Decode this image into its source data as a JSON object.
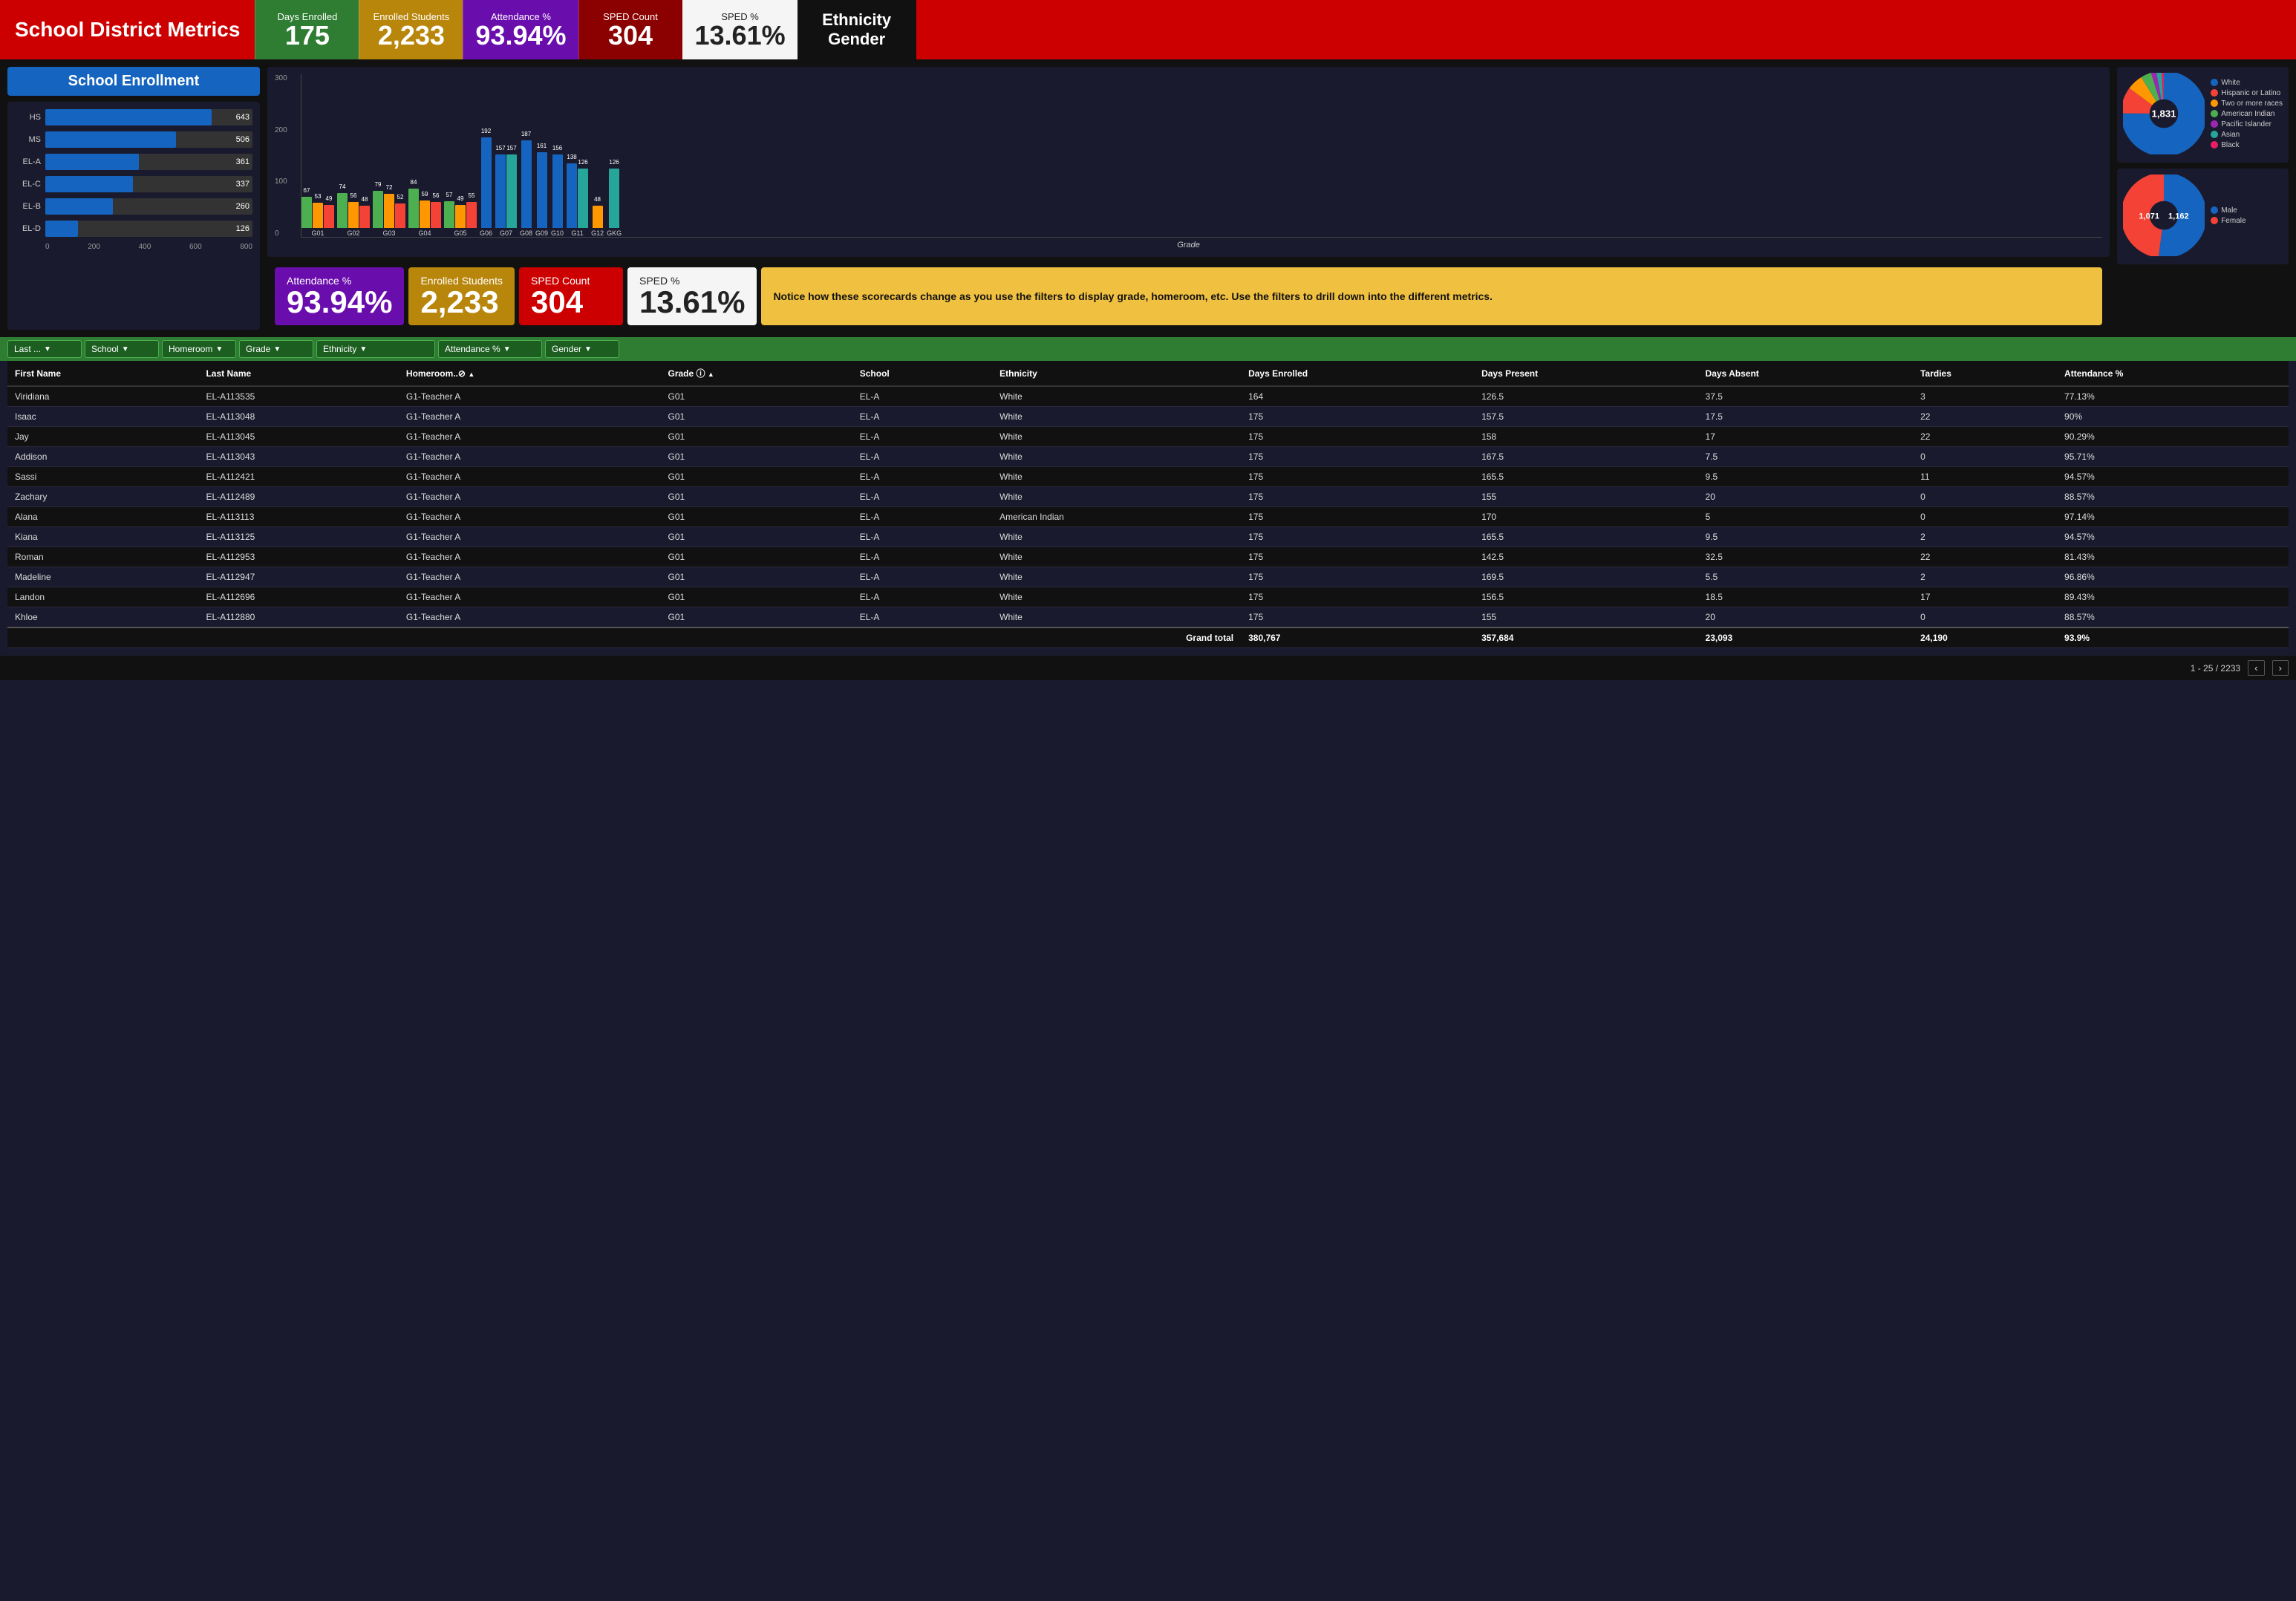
{
  "header": {
    "title": "School District Metrics",
    "metrics": [
      {
        "label": "Days Enrolled",
        "value": "175",
        "class": "green"
      },
      {
        "label": "Enrolled Students",
        "value": "2,233",
        "class": "gold"
      },
      {
        "label": "Attendance %",
        "value": "93.94%",
        "class": "purple"
      },
      {
        "label": "SPED Count",
        "value": "304",
        "class": "dark-red"
      },
      {
        "label": "SPED %",
        "value": "13.61%",
        "class": "white-card"
      },
      {
        "label": "Ethnicity\nGender",
        "value": "",
        "class": "ethnicity"
      }
    ]
  },
  "enrollment": {
    "title": "School Enrollment",
    "bars": [
      {
        "label": "HS",
        "value": 643,
        "max": 800
      },
      {
        "label": "MS",
        "value": 506,
        "max": 800
      },
      {
        "label": "EL-A",
        "value": 361,
        "max": 800
      },
      {
        "label": "EL-C",
        "value": 337,
        "max": 800
      },
      {
        "label": "EL-B",
        "value": 260,
        "max": 800
      },
      {
        "label": "EL-D",
        "value": 126,
        "max": 800
      }
    ],
    "x_axis": [
      "0",
      "200",
      "400",
      "600",
      "800"
    ]
  },
  "grade_chart": {
    "title": "Grade",
    "y_labels": [
      "300",
      "200",
      "100",
      "0"
    ],
    "grades": [
      {
        "id": "G01",
        "bars": [
          {
            "val": 67,
            "color": "#4caf50"
          },
          {
            "val": 53,
            "color": "#ff9800"
          },
          {
            "val": 49,
            "color": "#f44336"
          }
        ]
      },
      {
        "id": "G02",
        "bars": [
          {
            "val": 74,
            "color": "#4caf50"
          },
          {
            "val": 56,
            "color": "#ff9800"
          },
          {
            "val": 48,
            "color": "#f44336"
          }
        ]
      },
      {
        "id": "G03",
        "bars": [
          {
            "val": 79,
            "color": "#4caf50"
          },
          {
            "val": 72,
            "color": "#ff9800"
          },
          {
            "val": 52,
            "color": "#f44336"
          }
        ]
      },
      {
        "id": "G04",
        "bars": [
          {
            "val": 84,
            "color": "#4caf50"
          },
          {
            "val": 59,
            "color": "#ff9800"
          },
          {
            "val": 56,
            "color": "#f44336"
          }
        ]
      },
      {
        "id": "G05",
        "bars": [
          {
            "val": 57,
            "color": "#4caf50"
          },
          {
            "val": 49,
            "color": "#ff9800"
          },
          {
            "val": 55,
            "color": "#f44336"
          }
        ]
      },
      {
        "id": "G06",
        "bars": [
          {
            "val": 192,
            "color": "#1565c0"
          },
          {
            "val": 0,
            "color": "transparent"
          },
          {
            "val": 0,
            "color": "transparent"
          }
        ]
      },
      {
        "id": "G07",
        "bars": [
          {
            "val": 157,
            "color": "#1565c0"
          },
          {
            "val": 157,
            "color": "#26a69a"
          },
          {
            "val": 0,
            "color": "transparent"
          }
        ]
      },
      {
        "id": "G08",
        "bars": [
          {
            "val": 187,
            "color": "#1565c0"
          },
          {
            "val": 0,
            "color": "transparent"
          },
          {
            "val": 0,
            "color": "transparent"
          }
        ]
      },
      {
        "id": "G09",
        "bars": [
          {
            "val": 161,
            "color": "#1565c0"
          },
          {
            "val": 0,
            "color": "transparent"
          },
          {
            "val": 0,
            "color": "transparent"
          }
        ]
      },
      {
        "id": "G10",
        "bars": [
          {
            "val": 156,
            "color": "#1565c0"
          },
          {
            "val": 0,
            "color": "transparent"
          },
          {
            "val": 0,
            "color": "transparent"
          }
        ]
      },
      {
        "id": "G11",
        "bars": [
          {
            "val": 138,
            "color": "#1565c0"
          },
          {
            "val": 126,
            "color": "#26a69a"
          },
          {
            "val": 0,
            "color": "transparent"
          }
        ]
      },
      {
        "id": "G12",
        "bars": [
          {
            "val": 48,
            "color": "#ff9800"
          },
          {
            "val": 0,
            "color": "transparent"
          },
          {
            "val": 0,
            "color": "transparent"
          }
        ]
      },
      {
        "id": "GKG",
        "bars": [
          {
            "val": 126,
            "color": "#26a69a"
          },
          {
            "val": 0,
            "color": "transparent"
          },
          {
            "val": 0,
            "color": "transparent"
          }
        ]
      }
    ]
  },
  "pie_ethnicity": {
    "title": "Ethnicity",
    "total": 1831,
    "segments": [
      {
        "label": "White",
        "color": "#1565c0",
        "pct": 75
      },
      {
        "label": "Hispanic or Latino",
        "color": "#f44336",
        "pct": 10
      },
      {
        "label": "Two or more races",
        "color": "#ff9800",
        "pct": 6
      },
      {
        "label": "American Indian",
        "color": "#4caf50",
        "pct": 4
      },
      {
        "label": "Pacific Islander",
        "color": "#9c27b0",
        "pct": 2
      },
      {
        "label": "Asian",
        "color": "#26a69a",
        "pct": 2
      },
      {
        "label": "Black",
        "color": "#e91e63",
        "pct": 1
      }
    ],
    "center_label": "1,831"
  },
  "pie_gender": {
    "title": "Gender",
    "segments": [
      {
        "label": "Male",
        "color": "#1565c0",
        "value": 1162
      },
      {
        "label": "Female",
        "color": "#f44336",
        "value": 1071
      }
    ]
  },
  "scorecards": [
    {
      "label": "Attendance %",
      "value": "93.94%",
      "class": "purple-sc"
    },
    {
      "label": "Enrolled Students",
      "value": "2,233",
      "class": "gold-sc"
    },
    {
      "label": "SPED Count",
      "value": "304",
      "class": "red-sc"
    },
    {
      "label": "SPED %",
      "value": "13.61%",
      "class": "white-sc"
    }
  ],
  "notice": "Notice how these scorecards change as you use the filters to display grade, homeroom, etc. Use the filters to drill down into the different metrics.",
  "filters": [
    {
      "label": "Last ...",
      "id": "filter-last"
    },
    {
      "label": "School",
      "id": "filter-school"
    },
    {
      "label": "Homeroom",
      "id": "filter-homeroom"
    },
    {
      "label": "Grade",
      "id": "filter-grade"
    },
    {
      "label": "Ethnicity",
      "id": "filter-ethnicity"
    },
    {
      "label": "Attendance %",
      "id": "filter-attendance"
    },
    {
      "label": "Gender",
      "id": "filter-gender"
    }
  ],
  "table": {
    "columns": [
      "First Name",
      "Last Name",
      "Homeroom..⊘ ▲",
      "Grade ⓘ ▲",
      "School",
      "Ethnicity",
      "Days Enrolled",
      "Days Present",
      "Days Absent",
      "Tardies",
      "Attendance %"
    ],
    "rows": [
      [
        "Viridiana",
        "EL-A113535",
        "G1-Teacher A",
        "G01",
        "EL-A",
        "White",
        "164",
        "126.5",
        "37.5",
        "3",
        "77.13%"
      ],
      [
        "Isaac",
        "EL-A113048",
        "G1-Teacher A",
        "G01",
        "EL-A",
        "White",
        "175",
        "157.5",
        "17.5",
        "22",
        "90%"
      ],
      [
        "Jay",
        "EL-A113045",
        "G1-Teacher A",
        "G01",
        "EL-A",
        "White",
        "175",
        "158",
        "17",
        "22",
        "90.29%"
      ],
      [
        "Addison",
        "EL-A113043",
        "G1-Teacher A",
        "G01",
        "EL-A",
        "White",
        "175",
        "167.5",
        "7.5",
        "0",
        "95.71%"
      ],
      [
        "Sassi",
        "EL-A112421",
        "G1-Teacher A",
        "G01",
        "EL-A",
        "White",
        "175",
        "165.5",
        "9.5",
        "11",
        "94.57%"
      ],
      [
        "Zachary",
        "EL-A112489",
        "G1-Teacher A",
        "G01",
        "EL-A",
        "White",
        "175",
        "155",
        "20",
        "0",
        "88.57%"
      ],
      [
        "Alana",
        "EL-A113113",
        "G1-Teacher A",
        "G01",
        "EL-A",
        "American Indian",
        "175",
        "170",
        "5",
        "0",
        "97.14%"
      ],
      [
        "Kiana",
        "EL-A113125",
        "G1-Teacher A",
        "G01",
        "EL-A",
        "White",
        "175",
        "165.5",
        "9.5",
        "2",
        "94.57%"
      ],
      [
        "Roman",
        "EL-A112953",
        "G1-Teacher A",
        "G01",
        "EL-A",
        "White",
        "175",
        "142.5",
        "32.5",
        "22",
        "81.43%"
      ],
      [
        "Madeline",
        "EL-A112947",
        "G1-Teacher A",
        "G01",
        "EL-A",
        "White",
        "175",
        "169.5",
        "5.5",
        "2",
        "96.86%"
      ],
      [
        "Landon",
        "EL-A112696",
        "G1-Teacher A",
        "G01",
        "EL-A",
        "White",
        "175",
        "156.5",
        "18.5",
        "17",
        "89.43%"
      ],
      [
        "Khloe",
        "EL-A112880",
        "G1-Teacher A",
        "G01",
        "EL-A",
        "White",
        "175",
        "155",
        "20",
        "0",
        "88.57%"
      ]
    ],
    "grand_total": {
      "label": "Grand total",
      "days_enrolled": "380,767",
      "days_present": "357,684",
      "days_absent": "23,093",
      "tardies": "24,190",
      "attendance": "93.9%"
    },
    "pagination": "1 - 25 / 2233"
  }
}
